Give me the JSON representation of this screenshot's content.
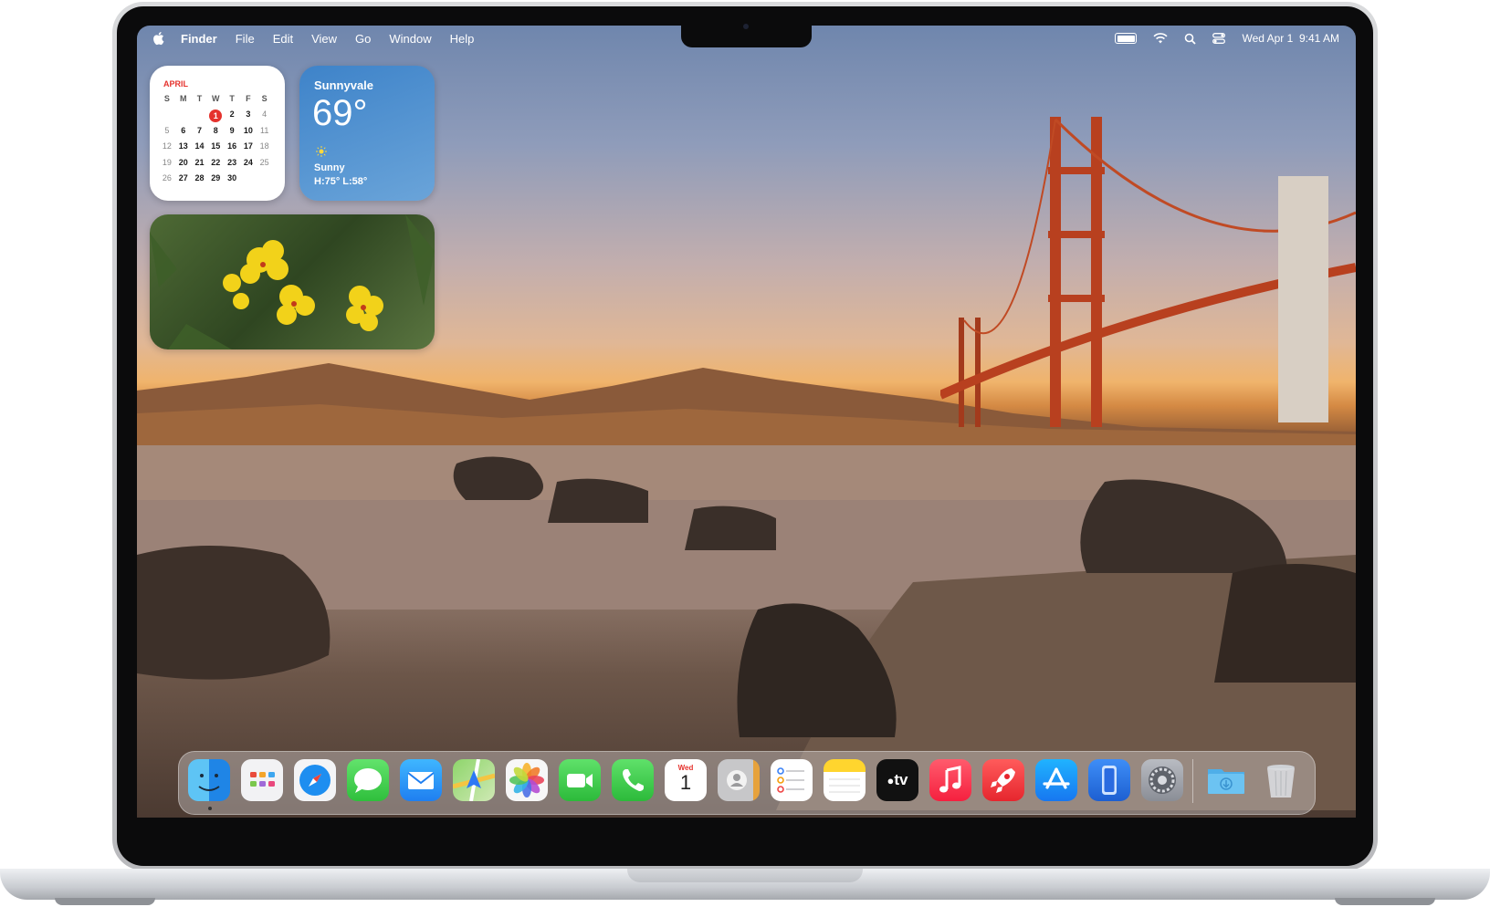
{
  "menubar": {
    "app_name": "Finder",
    "items": [
      "File",
      "Edit",
      "View",
      "Go",
      "Window",
      "Help"
    ],
    "clock": "Wed Apr 1  9:41 AM"
  },
  "calendar_widget": {
    "month": "APRIL",
    "weekdays": [
      "S",
      "M",
      "T",
      "W",
      "T",
      "F",
      "S"
    ],
    "weeks": [
      [
        "",
        "",
        "",
        "1",
        "2",
        "3",
        "4"
      ],
      [
        "5",
        "6",
        "7",
        "8",
        "9",
        "10",
        "11"
      ],
      [
        "12",
        "13",
        "14",
        "15",
        "16",
        "17",
        "18"
      ],
      [
        "19",
        "20",
        "21",
        "22",
        "23",
        "24",
        "25"
      ],
      [
        "26",
        "27",
        "28",
        "29",
        "30",
        "",
        ""
      ]
    ],
    "today": "1"
  },
  "weather_widget": {
    "city": "Sunnyvale",
    "temperature": "69°",
    "condition": "Sunny",
    "high_low": "H:75° L:58°"
  },
  "dock": {
    "calendar_icon_day": "Wed",
    "calendar_icon_date": "1",
    "tv_label": "tv"
  },
  "colors": {
    "accent_red": "#e5322d",
    "weather_blue": "#3e83c9"
  }
}
